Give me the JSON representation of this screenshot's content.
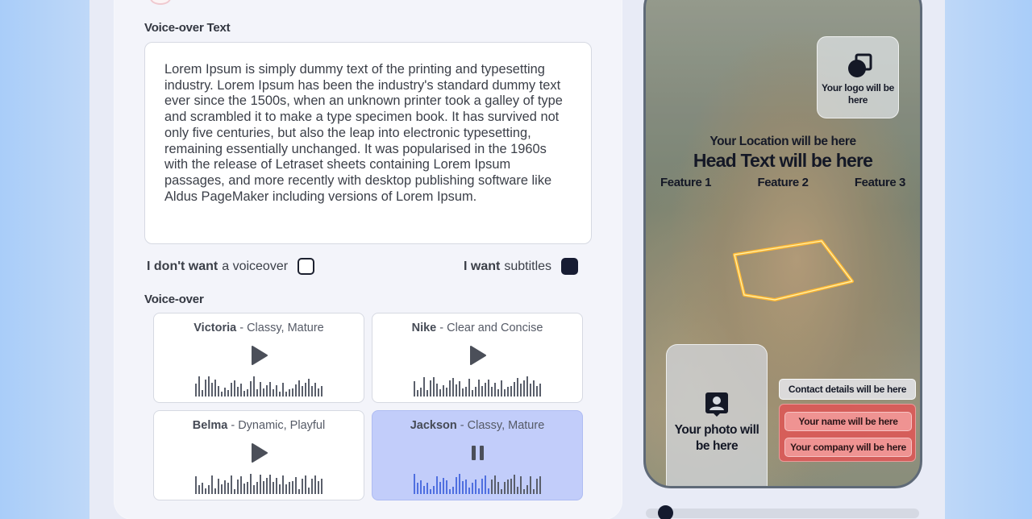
{
  "voiceover_text": {
    "label": "Voice-over Text",
    "content": "Lorem Ipsum is simply dummy text of the printing and typesetting industry. Lorem Ipsum has been the industry's standard dummy text ever since the 1500s, when an unknown printer took a galley of type and scrambled it to make a type specimen book. It has survived not only five centuries, but also the leap into electronic typesetting, remaining essentially unchanged. It was popularised in the 1960s with the release of Letraset sheets containing Lorem Ipsum passages, and more recently with desktop publishing software like Aldus PageMaker including versions of Lorem Ipsum."
  },
  "options": {
    "no_voiceover_bold": "I don't want",
    "no_voiceover_rest": "a voiceover",
    "no_voiceover_checked": false,
    "subtitles_bold": "I want",
    "subtitles_rest": "subtitles",
    "subtitles_checked": true
  },
  "voiceover": {
    "label": "Voice-over",
    "voices": [
      {
        "name": "Victoria",
        "desc": " - Classy, Mature",
        "state": "play",
        "selected": false
      },
      {
        "name": "Nike",
        "desc": " - Clear and Concise",
        "state": "play",
        "selected": false
      },
      {
        "name": "Belma",
        "desc": " - Dynamic, Playful",
        "state": "play",
        "selected": false
      },
      {
        "name": "Jackson",
        "desc": " - Classy, Mature",
        "state": "pause",
        "selected": true
      }
    ]
  },
  "preview": {
    "logo_placeholder": "Your logo will be here",
    "location": "Your Location will be here",
    "head_text": "Head Text will be here",
    "features": [
      "Feature 1",
      "Feature 2",
      "Feature 3"
    ],
    "photo_placeholder": "Your photo will be here",
    "contact_details": "Contact details will be here",
    "name_placeholder": "Your name will be here",
    "company_placeholder": "Your company will be here",
    "progress": 0.05
  },
  "colors": {
    "accent_dark": "#171c33",
    "selected_card": "#c2cdfa",
    "wave_active": "#4f6fe0"
  }
}
